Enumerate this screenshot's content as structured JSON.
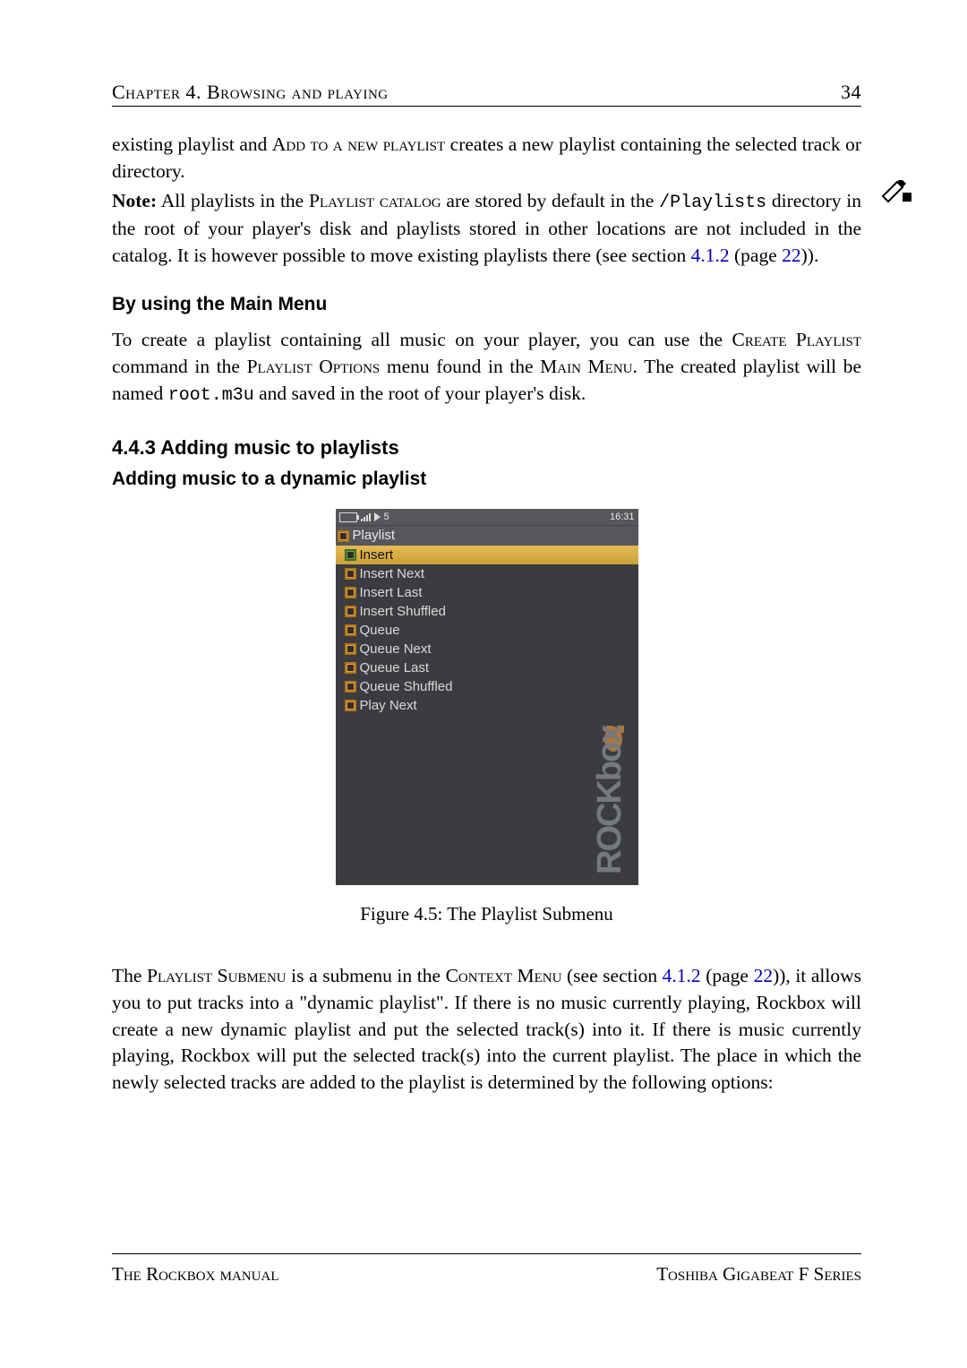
{
  "header": {
    "left": "Chapter 4.  Browsing and playing",
    "right": "34"
  },
  "p1_a": "existing playlist and ",
  "p1_sc1": "Add to a new playlist",
  "p1_b": " creates a new playlist containing the selected track or directory.",
  "p2_note": "Note:",
  "p2_a": " All playlists in the ",
  "p2_sc1": "Playlist catalog",
  "p2_b": " are stored by default in the ",
  "p2_tt": "/Playlists",
  "p2_c": " directory in the root of your player's disk and playlists stored in other locations are not included in the catalog. It is however possible to move existing playlists there (see section ",
  "p2_link1": "4.1.2",
  "p2_d": " (page ",
  "p2_link2": "22",
  "p2_e": ")).",
  "h_sub1": "By using the Main Menu",
  "p3_a": "To create a playlist containing all music on your player, you can use the ",
  "p3_sc1": "Create Playlist",
  "p3_b": " command in the ",
  "p3_sc2": "Playlist Options",
  "p3_c": " menu found in the ",
  "p3_sc3": "Main Menu",
  "p3_d": ". The created playlist will be named ",
  "p3_tt": "root.m3u",
  "p3_e": " and saved in the root of your player's disk.",
  "h_sec": "4.4.3  Adding music to playlists",
  "h_sub2": "Adding music to a dynamic playlist",
  "shot": {
    "status_count": "5",
    "status_time": "16:31",
    "title": "Playlist",
    "items": [
      {
        "label": "Insert",
        "selected": true,
        "color": "grn"
      },
      {
        "label": "Insert Next",
        "selected": false,
        "color": "org"
      },
      {
        "label": "Insert Last",
        "selected": false,
        "color": "org"
      },
      {
        "label": "Insert Shuffled",
        "selected": false,
        "color": "org"
      },
      {
        "label": "Queue",
        "selected": false,
        "color": "org"
      },
      {
        "label": "Queue Next",
        "selected": false,
        "color": "org"
      },
      {
        "label": "Queue Last",
        "selected": false,
        "color": "org"
      },
      {
        "label": "Queue Shuffled",
        "selected": false,
        "color": "org"
      },
      {
        "label": "Play Next",
        "selected": false,
        "color": "org"
      }
    ]
  },
  "fig_caption": "Figure 4.5: The Playlist Submenu",
  "p4_a": "The ",
  "p4_sc1": "Playlist Submenu",
  "p4_b": " is a submenu in the ",
  "p4_sc2": "Context Menu",
  "p4_c": " (see section ",
  "p4_link1": "4.1.2",
  "p4_d": " (page ",
  "p4_link2": "22",
  "p4_e": ")), it allows you to put tracks into a \"dynamic playlist\". If there is no music currently playing, Rockbox will create a new dynamic playlist and put the selected track(s) into it. If there is music currently playing, Rockbox will put the selected track(s) into the current playlist. The place in which the newly selected tracks are added to the playlist is determined by the following options:",
  "footer": {
    "left": "The Rockbox manual",
    "right": "Toshiba Gigabeat F Series"
  }
}
